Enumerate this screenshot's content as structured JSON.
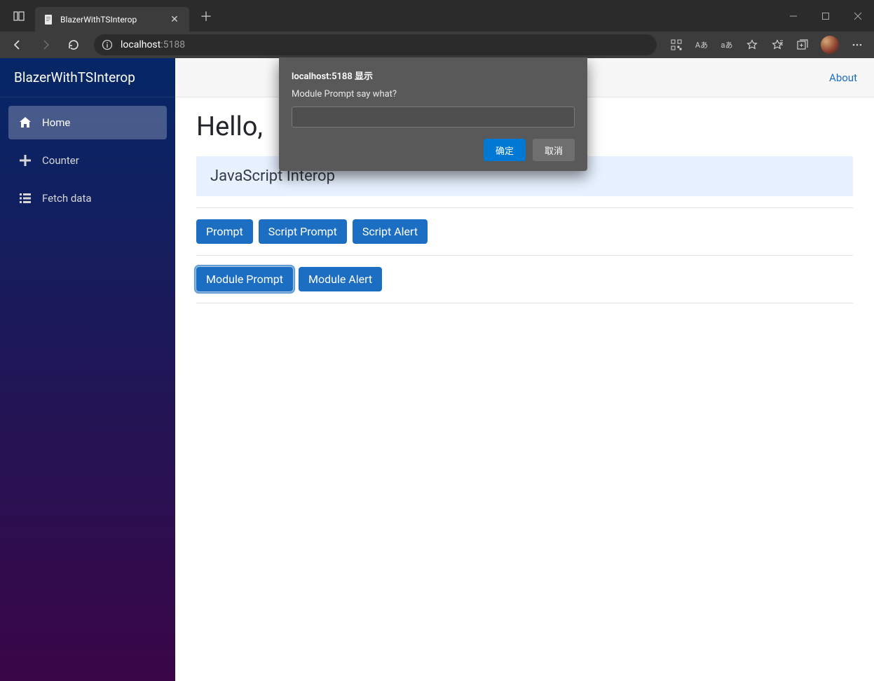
{
  "browser": {
    "tab_title": "BlazerWithTSInterop",
    "url_host": "localhost",
    "url_port": ":5188",
    "address_bar_icons": {
      "read_aloud": "Aあ",
      "translate": "aあ"
    }
  },
  "sidebar": {
    "brand": "BlazerWithTSInterop",
    "items": [
      {
        "label": "Home"
      },
      {
        "label": "Counter"
      },
      {
        "label": "Fetch data"
      }
    ]
  },
  "top_row": {
    "about": "About"
  },
  "page": {
    "heading": "Hello,",
    "card_title": "JavaScript Interop",
    "buttons_row1": [
      {
        "label": "Prompt"
      },
      {
        "label": "Script Prompt"
      },
      {
        "label": "Script Alert"
      }
    ],
    "buttons_row2": [
      {
        "label": "Module Prompt"
      },
      {
        "label": "Module Alert"
      }
    ]
  },
  "dialog": {
    "title": "localhost:5188 显示",
    "label": "Module Prompt say what?",
    "input_value": "",
    "ok": "确定",
    "cancel": "取消"
  }
}
